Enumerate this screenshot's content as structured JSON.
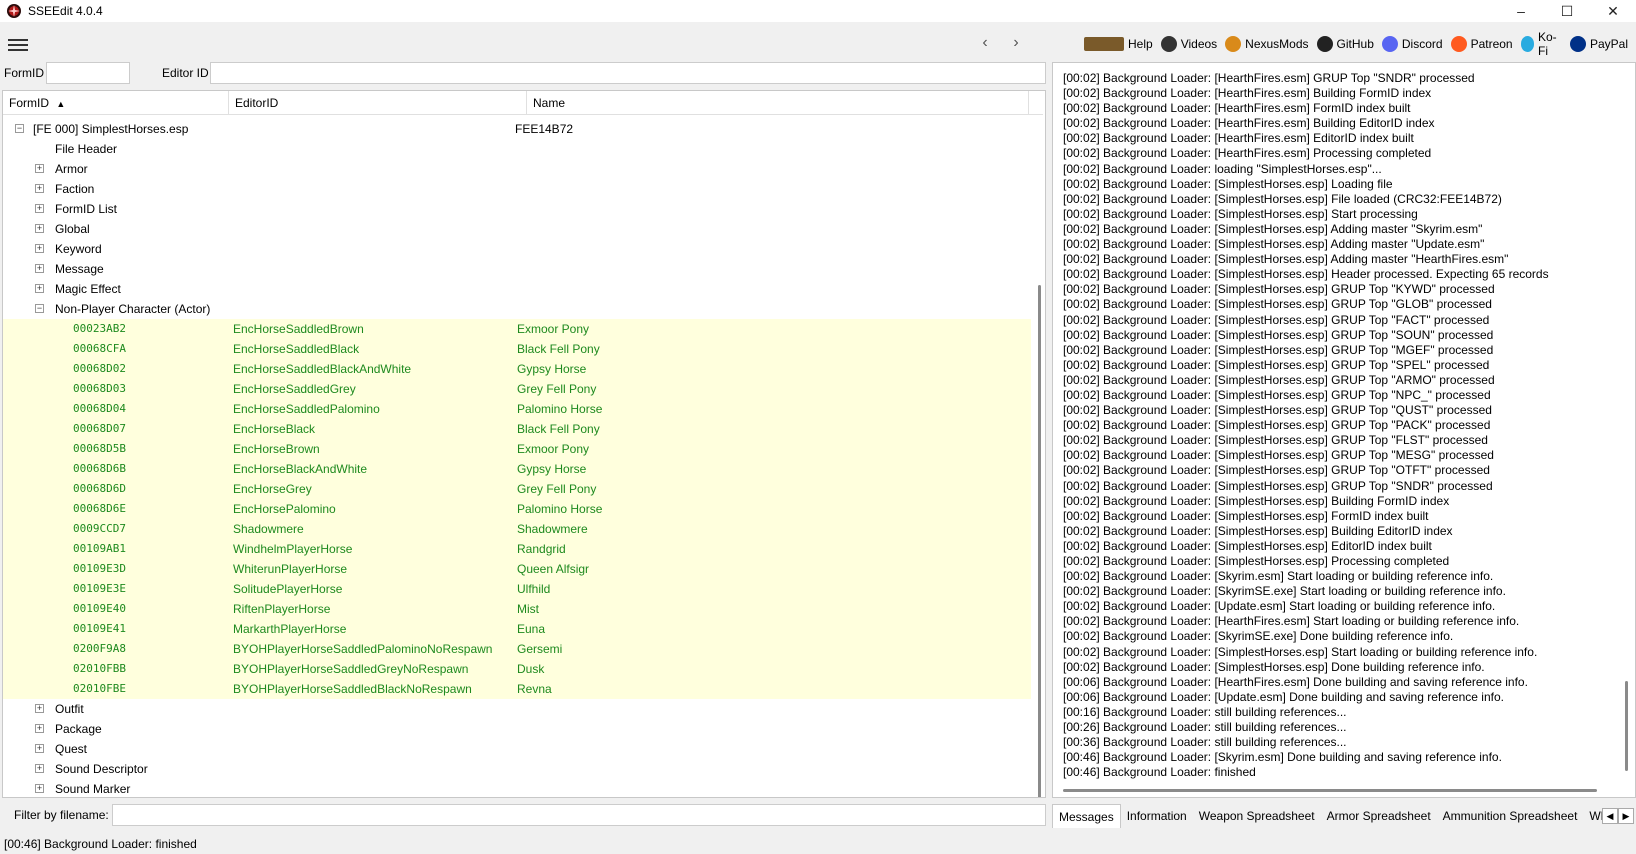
{
  "window": {
    "title": "SSEEdit 4.0.4"
  },
  "toolbar": {
    "back": "‹",
    "forward": "›",
    "links": [
      {
        "label": "Help",
        "icon": "book-icon",
        "color": "#7a5a2a"
      },
      {
        "label": "Videos",
        "icon": "videos-icon",
        "color": "#333333"
      },
      {
        "label": "NexusMods",
        "icon": "nexusmods-icon",
        "color": "#d98a1a"
      },
      {
        "label": "GitHub",
        "icon": "github-icon",
        "color": "#222222"
      },
      {
        "label": "Discord",
        "icon": "discord-icon",
        "color": "#5865f2"
      },
      {
        "label": "Patreon",
        "icon": "patreon-icon",
        "color": "#ff5a1f"
      },
      {
        "label": "Ko-Fi",
        "icon": "kofi-icon",
        "color": "#29abe0"
      },
      {
        "label": "PayPal",
        "icon": "paypal-icon",
        "color": "#003087"
      }
    ]
  },
  "idbar": {
    "formid_label": "FormID",
    "editorid_label": "Editor ID"
  },
  "tree": {
    "columns": [
      "FormID",
      "EditorID",
      "Name"
    ],
    "plugin": {
      "label": "[FE 000] SimplestHorses.esp",
      "crc": "FEE14B72"
    },
    "groups_before": [
      "File Header",
      "Armor",
      "Faction",
      "FormID List",
      "Global",
      "Keyword",
      "Message",
      "Magic Effect"
    ],
    "npc_group": "Non-Player Character (Actor)",
    "npc_rows": [
      {
        "formid": "00023AB2",
        "editorid": "EncHorseSaddledBrown",
        "name": "Exmoor Pony"
      },
      {
        "formid": "00068CFA",
        "editorid": "EncHorseSaddledBlack",
        "name": "Black Fell Pony"
      },
      {
        "formid": "00068D02",
        "editorid": "EncHorseSaddledBlackAndWhite",
        "name": "Gypsy Horse"
      },
      {
        "formid": "00068D03",
        "editorid": "EncHorseSaddledGrey",
        "name": "Grey Fell Pony"
      },
      {
        "formid": "00068D04",
        "editorid": "EncHorseSaddledPalomino",
        "name": "Palomino Horse"
      },
      {
        "formid": "00068D07",
        "editorid": "EncHorseBlack",
        "name": "Black Fell Pony"
      },
      {
        "formid": "00068D5B",
        "editorid": "EncHorseBrown",
        "name": "Exmoor Pony"
      },
      {
        "formid": "00068D6B",
        "editorid": "EncHorseBlackAndWhite",
        "name": "Gypsy Horse"
      },
      {
        "formid": "00068D6D",
        "editorid": "EncHorseGrey",
        "name": "Grey Fell Pony"
      },
      {
        "formid": "00068D6E",
        "editorid": "EncHorsePalomino",
        "name": "Palomino Horse"
      },
      {
        "formid": "0009CCD7",
        "editorid": "Shadowmere",
        "name": "Shadowmere"
      },
      {
        "formid": "00109AB1",
        "editorid": "WindhelmPlayerHorse",
        "name": "Randgrid"
      },
      {
        "formid": "00109E3D",
        "editorid": "WhiterunPlayerHorse",
        "name": "Queen Alfsigr"
      },
      {
        "formid": "00109E3E",
        "editorid": "SolitudePlayerHorse",
        "name": "Ulfhild"
      },
      {
        "formid": "00109E40",
        "editorid": "RiftenPlayerHorse",
        "name": "Mist"
      },
      {
        "formid": "00109E41",
        "editorid": "MarkarthPlayerHorse",
        "name": "Euna"
      },
      {
        "formid": "0200F9A8",
        "editorid": "BYOHPlayerHorseSaddledPalominoNoRespawn",
        "name": "Gersemi"
      },
      {
        "formid": "02010FBB",
        "editorid": "BYOHPlayerHorseSaddledGreyNoRespawn",
        "name": "Dusk"
      },
      {
        "formid": "02010FBE",
        "editorid": "BYOHPlayerHorseSaddledBlackNoRespawn",
        "name": "Revna"
      }
    ],
    "groups_after": [
      "Outfit",
      "Package",
      "Quest",
      "Sound Descriptor",
      "Sound Marker"
    ]
  },
  "filter": {
    "label": "Filter by filename:"
  },
  "status": "[00:46] Background Loader: finished",
  "messages": [
    "[00:02] Background Loader: [HearthFires.esm] GRUP Top \"SNDR\" processed",
    "[00:02] Background Loader: [HearthFires.esm] Building FormID index",
    "[00:02] Background Loader: [HearthFires.esm] FormID index built",
    "[00:02] Background Loader: [HearthFires.esm] Building EditorID index",
    "[00:02] Background Loader: [HearthFires.esm] EditorID index built",
    "[00:02] Background Loader: [HearthFires.esm] Processing completed",
    "[00:02] Background Loader: loading \"SimplestHorses.esp\"...",
    "[00:02] Background Loader: [SimplestHorses.esp] Loading file",
    "[00:02] Background Loader: [SimplestHorses.esp] File loaded (CRC32:FEE14B72)",
    "[00:02] Background Loader: [SimplestHorses.esp] Start processing",
    "[00:02] Background Loader: [SimplestHorses.esp] Adding master \"Skyrim.esm\"",
    "[00:02] Background Loader: [SimplestHorses.esp] Adding master \"Update.esm\"",
    "[00:02] Background Loader: [SimplestHorses.esp] Adding master \"HearthFires.esm\"",
    "[00:02] Background Loader: [SimplestHorses.esp] Header processed. Expecting 65 records",
    "[00:02] Background Loader: [SimplestHorses.esp] GRUP Top \"KYWD\" processed",
    "[00:02] Background Loader: [SimplestHorses.esp] GRUP Top \"GLOB\" processed",
    "[00:02] Background Loader: [SimplestHorses.esp] GRUP Top \"FACT\" processed",
    "[00:02] Background Loader: [SimplestHorses.esp] GRUP Top \"SOUN\" processed",
    "[00:02] Background Loader: [SimplestHorses.esp] GRUP Top \"MGEF\" processed",
    "[00:02] Background Loader: [SimplestHorses.esp] GRUP Top \"SPEL\" processed",
    "[00:02] Background Loader: [SimplestHorses.esp] GRUP Top \"ARMO\" processed",
    "[00:02] Background Loader: [SimplestHorses.esp] GRUP Top \"NPC_\" processed",
    "[00:02] Background Loader: [SimplestHorses.esp] GRUP Top \"QUST\" processed",
    "[00:02] Background Loader: [SimplestHorses.esp] GRUP Top \"PACK\" processed",
    "[00:02] Background Loader: [SimplestHorses.esp] GRUP Top \"FLST\" processed",
    "[00:02] Background Loader: [SimplestHorses.esp] GRUP Top \"MESG\" processed",
    "[00:02] Background Loader: [SimplestHorses.esp] GRUP Top \"OTFT\" processed",
    "[00:02] Background Loader: [SimplestHorses.esp] GRUP Top \"SNDR\" processed",
    "[00:02] Background Loader: [SimplestHorses.esp] Building FormID index",
    "[00:02] Background Loader: [SimplestHorses.esp] FormID index built",
    "[00:02] Background Loader: [SimplestHorses.esp] Building EditorID index",
    "[00:02] Background Loader: [SimplestHorses.esp] EditorID index built",
    "[00:02] Background Loader: [SimplestHorses.esp] Processing completed",
    "[00:02] Background Loader: [Skyrim.esm] Start loading or building reference info.",
    "[00:02] Background Loader: [SkyrimSE.exe] Start loading or building reference info.",
    "[00:02] Background Loader: [Update.esm] Start loading or building reference info.",
    "[00:02] Background Loader: [HearthFires.esm] Start loading or building reference info.",
    "[00:02] Background Loader: [SkyrimSE.exe] Done building reference info.",
    "[00:02] Background Loader: [SimplestHorses.esp] Start loading or building reference info.",
    "[00:02] Background Loader: [SimplestHorses.esp] Done building reference info.",
    "[00:06] Background Loader: [HearthFires.esm] Done building and saving reference info.",
    "[00:06] Background Loader: [Update.esm] Done building and saving reference info.",
    "[00:16] Background Loader: still building references...",
    "[00:26] Background Loader: still building references...",
    "[00:36] Background Loader: still building references...",
    "[00:46] Background Loader: [Skyrim.esm] Done building and saving reference info.",
    "[00:46] Background Loader: finished"
  ],
  "tabs": [
    "Messages",
    "Information",
    "Weapon Spreadsheet",
    "Armor Spreadsheet",
    "Ammunition Spreadsheet",
    "Wh"
  ]
}
